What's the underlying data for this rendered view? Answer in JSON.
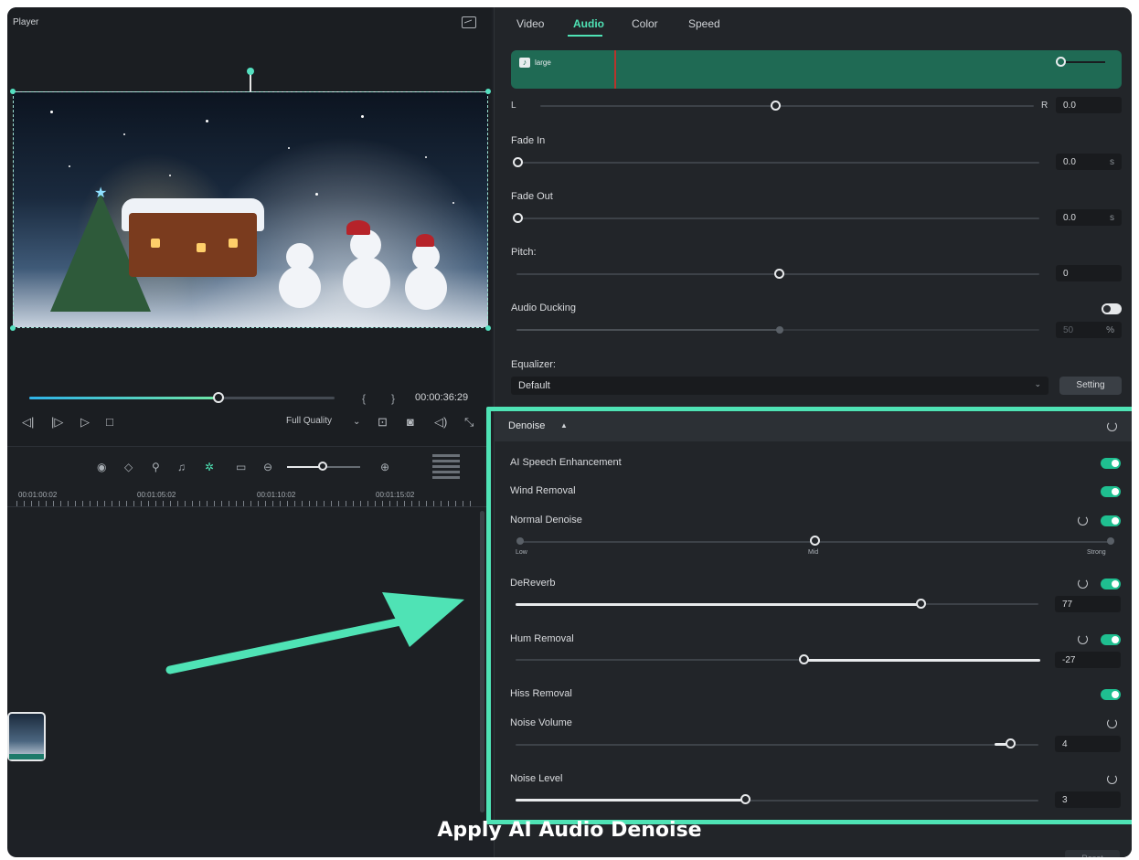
{
  "player": {
    "title": "Player",
    "timecode": "00:00:36:29",
    "quality": "Full Quality",
    "bracket_in": "{",
    "bracket_out": "}",
    "progress": 0.62
  },
  "timeline": {
    "ruler": [
      "00:01:00:02",
      "00:01:05:02",
      "00:01:10:02",
      "00:01:15:02"
    ]
  },
  "tabs": [
    "Video",
    "Audio",
    "Color",
    "Speed"
  ],
  "active_tab": "Audio",
  "audio": {
    "clip_name": "large",
    "balance": {
      "left": "L",
      "right": "R",
      "value": "0.0"
    },
    "fade_in": {
      "label": "Fade In",
      "value": "0.0",
      "unit": "s"
    },
    "fade_out": {
      "label": "Fade Out",
      "value": "0.0",
      "unit": "s"
    },
    "pitch": {
      "label": "Pitch:",
      "value": "0"
    },
    "ducking": {
      "label": "Audio Ducking",
      "value": "50",
      "unit": "%"
    },
    "equalizer": {
      "label": "Equalizer:",
      "value": "Default",
      "button": "Setting"
    }
  },
  "denoise": {
    "title": "Denoise",
    "ai_speech": "AI Speech Enhancement",
    "wind": "Wind Removal",
    "normal": {
      "label": "Normal Denoise",
      "levels": [
        "Low",
        "Mid",
        "Strong"
      ]
    },
    "dereverb": {
      "label": "DeReverb",
      "value": "77"
    },
    "hum": {
      "label": "Hum Removal",
      "value": "-27"
    },
    "hiss": "Hiss Removal",
    "noise_volume": {
      "label": "Noise Volume",
      "value": "4"
    },
    "noise_level": {
      "label": "Noise Level",
      "value": "3"
    }
  },
  "caption": "Apply AI Audio Denoise",
  "reset_button": "Reset",
  "colors": {
    "accent": "#4fe3b5",
    "toggle_on": "#1fbf90",
    "clip": "#1f6a54"
  }
}
